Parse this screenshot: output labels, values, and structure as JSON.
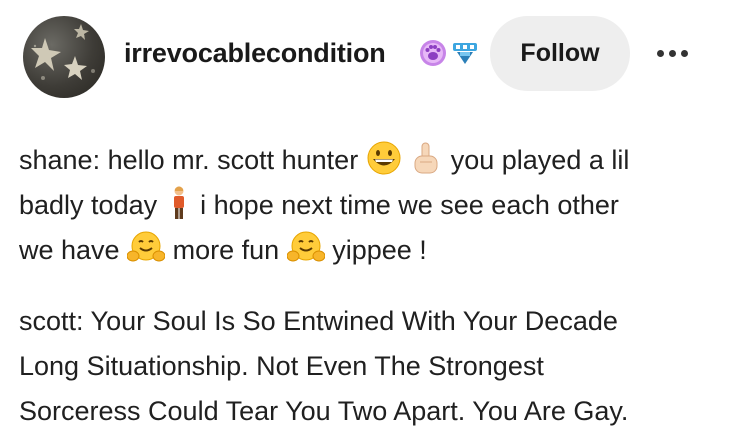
{
  "header": {
    "username": "irrevocablecondition",
    "badge_icons": [
      "paw-badge-icon",
      "blue-ribbon-badge-icon"
    ],
    "follow_label": "Follow",
    "more_icon": "ellipsis-icon"
  },
  "post": {
    "paragraph1": {
      "line1_a": "shane: hello mr. scott hunter",
      "line1_b": "you played a lil",
      "line2_a": "badly today",
      "line2_b": "i hope next time we see each other",
      "line3_a": "we have",
      "line3_b": "more fun",
      "line3_c": "yippee !"
    },
    "paragraph2": {
      "line1": "scott: Your Soul Is So Entwined With Your Decade",
      "line2": "Long Situationship. Not Even The Strongest",
      "line3": "Sorceress Could Tear You Two Apart. You Are Gay."
    },
    "emoji_icons": [
      "grinning-face-icon",
      "index-pointing-up-icon",
      "person-standing-icon",
      "hugging-face-icon"
    ]
  },
  "colors": {
    "background": "#ffffff",
    "text": "#202020",
    "follow_bg": "#eeeeee"
  }
}
